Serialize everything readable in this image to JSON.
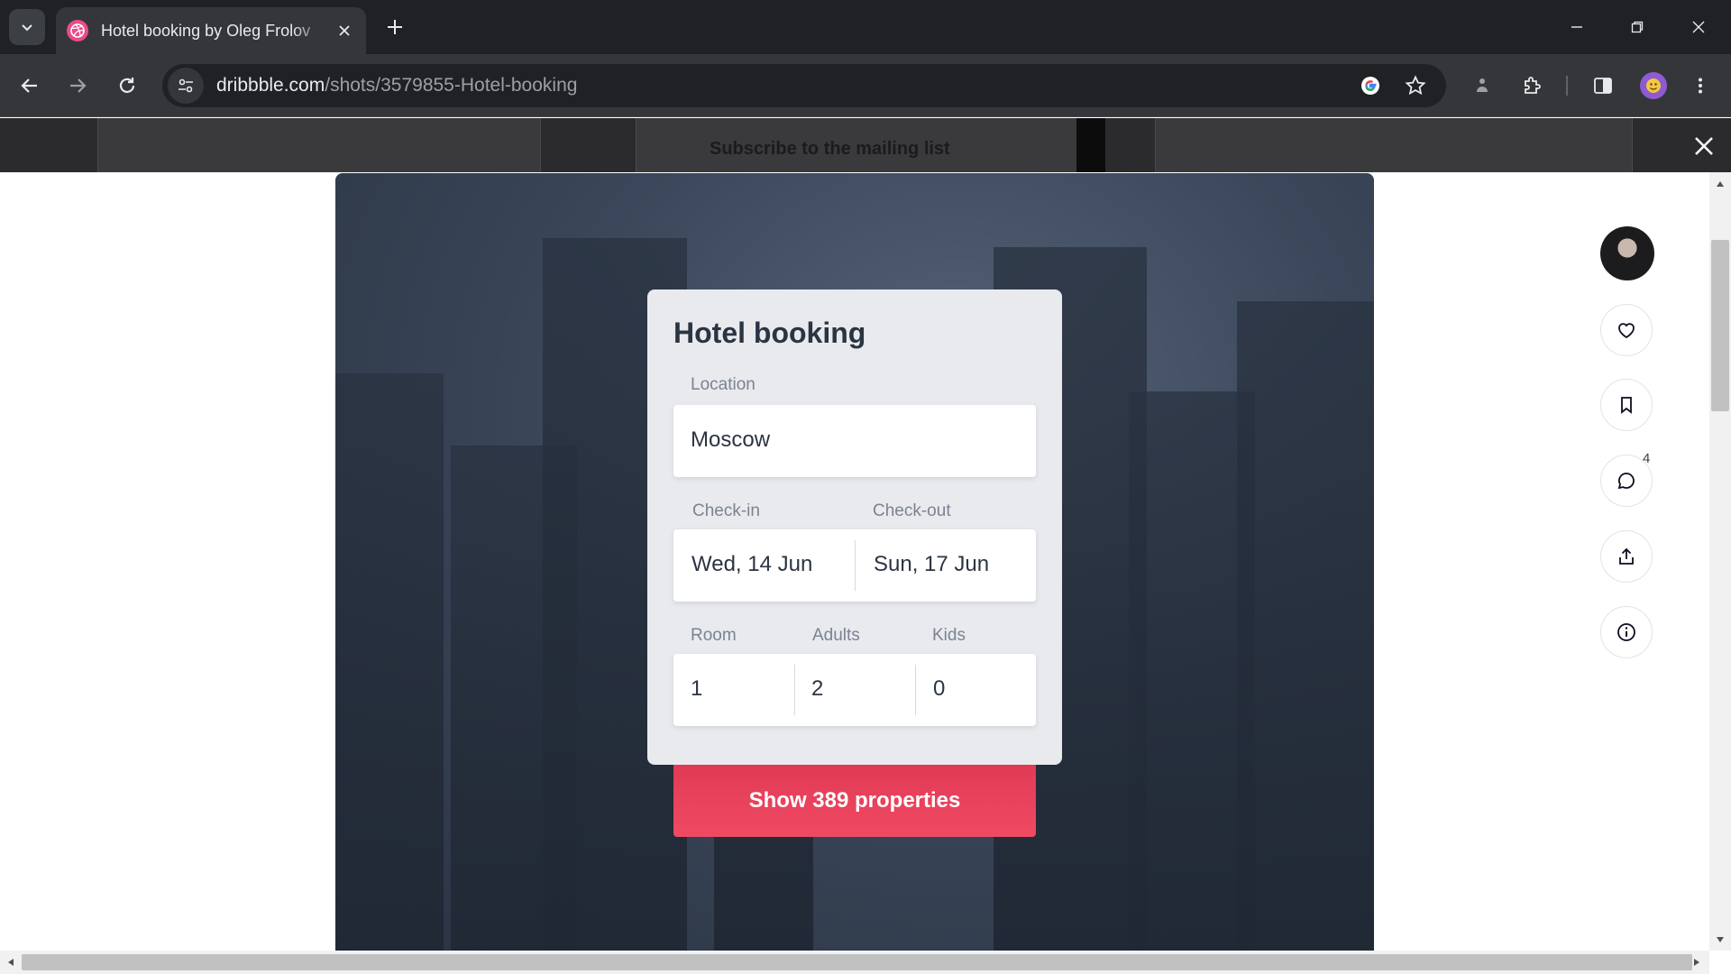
{
  "browser": {
    "tab_title": "Hotel booking by Oleg Frolov",
    "url_host": "dribbble.com",
    "url_path": "/shots/3579855-Hotel-booking"
  },
  "background_page": {
    "mailing_text": "Subscribe to the mailing list"
  },
  "shot": {
    "card_title": "Hotel booking",
    "location_label": "Location",
    "location_value": "Moscow",
    "checkin_label": "Check-in",
    "checkout_label": "Check-out",
    "checkin_value": "Wed, 14 Jun",
    "checkout_value": "Sun, 17 Jun",
    "room_label": "Room",
    "adults_label": "Adults",
    "kids_label": "Kids",
    "room_value": "1",
    "adults_value": "2",
    "kids_value": "0",
    "cta_label": "Show 389 properties",
    "accent_color": "#f04a63"
  },
  "sidebar": {
    "comments_count": "4"
  }
}
